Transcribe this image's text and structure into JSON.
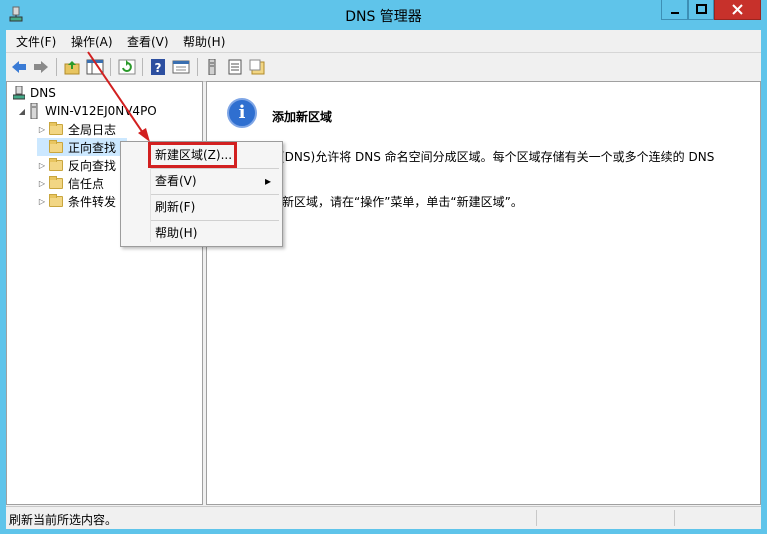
{
  "window": {
    "title": "DNS 管理器"
  },
  "menubar": {
    "items": [
      "文件(F)",
      "操作(A)",
      "查看(V)",
      "帮助(H)"
    ]
  },
  "toolbar": {
    "icons": [
      "back-arrow-icon",
      "forward-arrow-icon",
      "up-folder-icon",
      "show-tree-icon",
      "refresh-icon",
      "help-icon",
      "properties-icon",
      "server-icon",
      "list-icon",
      "zone-icon"
    ]
  },
  "tree": {
    "root": "DNS",
    "server": "WIN-V12EJ0NV4PO",
    "items": [
      "全局日志",
      "正向查找",
      "反向查找",
      "信任点",
      "条件转发"
    ]
  },
  "detail": {
    "title": "添加新区域",
    "line1": "(DNS)允许将 DNS 命名空间分成区域。每个区域存储有关一个或多个连续的 DNS",
    "line2": "新区域，请在“操作”菜单，单击“新建区域”。"
  },
  "context_menu": {
    "items": [
      "新建区域(Z)...",
      "查看(V)",
      "刷新(F)",
      "帮助(H)"
    ],
    "submenu_arrow": "▸"
  },
  "status": {
    "text": "刷新当前所选内容。"
  },
  "colors": {
    "titlebar": "#5fc4ea",
    "close": "#c7312b",
    "highlight_border": "#d22020"
  }
}
